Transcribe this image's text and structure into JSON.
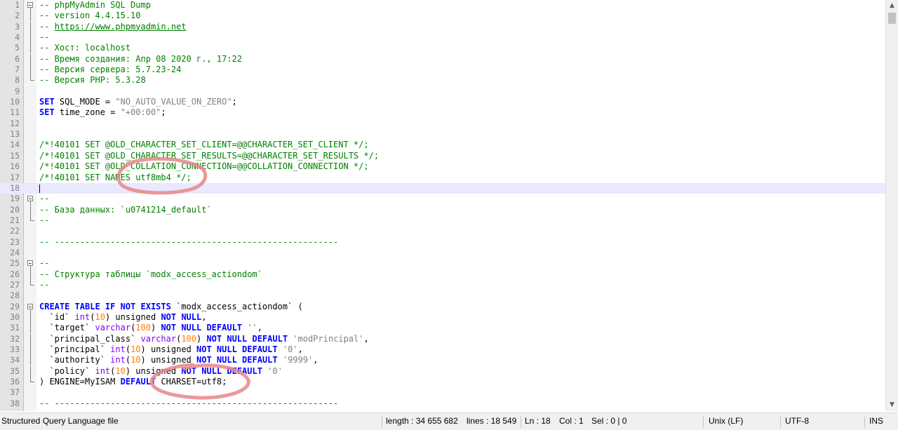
{
  "editor": {
    "current_line": 18,
    "lines": [
      {
        "n": "1",
        "fold": "open",
        "segs": [
          [
            "comment",
            "-- phpMyAdmin SQL Dump"
          ]
        ]
      },
      {
        "n": "2",
        "fold": "mid",
        "segs": [
          [
            "comment",
            "-- version 4.4.15.10"
          ]
        ]
      },
      {
        "n": "3",
        "fold": "mid",
        "segs": [
          [
            "comment",
            "-- "
          ],
          [
            "link",
            "https://www.phpmyadmin.net"
          ]
        ]
      },
      {
        "n": "4",
        "fold": "mid",
        "segs": [
          [
            "comment",
            "--"
          ]
        ]
      },
      {
        "n": "5",
        "fold": "mid",
        "segs": [
          [
            "comment",
            "-- Хост: localhost"
          ]
        ]
      },
      {
        "n": "6",
        "fold": "mid",
        "segs": [
          [
            "comment",
            "-- Время создания: Апр 08 2020 г., 17:22"
          ]
        ]
      },
      {
        "n": "7",
        "fold": "mid",
        "segs": [
          [
            "comment",
            "-- Версия сервера: 5.7.23-24"
          ]
        ]
      },
      {
        "n": "8",
        "fold": "end",
        "segs": [
          [
            "comment",
            "-- Версия PHP: 5.3.28"
          ]
        ]
      },
      {
        "n": "9",
        "fold": "",
        "segs": []
      },
      {
        "n": "10",
        "fold": "",
        "segs": [
          [
            "kw",
            "SET"
          ],
          [
            "txt",
            " SQL_MODE = "
          ],
          [
            "str",
            "\"NO_AUTO_VALUE_ON_ZERO\""
          ],
          [
            "txt",
            ";"
          ]
        ]
      },
      {
        "n": "11",
        "fold": "",
        "segs": [
          [
            "kw",
            "SET"
          ],
          [
            "txt",
            " time_zone = "
          ],
          [
            "str",
            "\"+00:00\""
          ],
          [
            "txt",
            ";"
          ]
        ]
      },
      {
        "n": "12",
        "fold": "",
        "segs": []
      },
      {
        "n": "13",
        "fold": "",
        "segs": []
      },
      {
        "n": "14",
        "fold": "",
        "segs": [
          [
            "comment",
            "/*!40101 SET @OLD_CHARACTER_SET_CLIENT=@@CHARACTER_SET_CLIENT */;"
          ]
        ]
      },
      {
        "n": "15",
        "fold": "",
        "segs": [
          [
            "comment",
            "/*!40101 SET @OLD_CHARACTER_SET_RESULTS=@@CHARACTER_SET_RESULTS */;"
          ]
        ]
      },
      {
        "n": "16",
        "fold": "",
        "segs": [
          [
            "comment",
            "/*!40101 SET @OLD_COLLATION_CONNECTION=@@COLLATION_CONNECTION */;"
          ]
        ]
      },
      {
        "n": "17",
        "fold": "",
        "segs": [
          [
            "comment",
            "/*!40101 SET NAMES utf8mb4 */;"
          ]
        ]
      },
      {
        "n": "18",
        "fold": "",
        "segs": []
      },
      {
        "n": "19",
        "fold": "open",
        "segs": [
          [
            "comment",
            "--"
          ]
        ]
      },
      {
        "n": "20",
        "fold": "mid",
        "segs": [
          [
            "comment",
            "-- База данных: `u0741214_default`"
          ]
        ]
      },
      {
        "n": "21",
        "fold": "end",
        "segs": [
          [
            "comment",
            "--"
          ]
        ]
      },
      {
        "n": "22",
        "fold": "",
        "segs": []
      },
      {
        "n": "23",
        "fold": "",
        "segs": [
          [
            "comment",
            "-- --------------------------------------------------------"
          ]
        ]
      },
      {
        "n": "24",
        "fold": "",
        "segs": []
      },
      {
        "n": "25",
        "fold": "open",
        "segs": [
          [
            "comment",
            "--"
          ]
        ]
      },
      {
        "n": "26",
        "fold": "mid",
        "segs": [
          [
            "comment",
            "-- Структура таблицы `modx_access_actiondom`"
          ]
        ]
      },
      {
        "n": "27",
        "fold": "end",
        "segs": [
          [
            "comment",
            "--"
          ]
        ]
      },
      {
        "n": "28",
        "fold": "",
        "segs": []
      },
      {
        "n": "29",
        "fold": "open",
        "segs": [
          [
            "kw",
            "CREATE TABLE IF NOT EXISTS"
          ],
          [
            "txt",
            " `modx_access_actiondom` ("
          ]
        ]
      },
      {
        "n": "30",
        "fold": "mid",
        "segs": [
          [
            "txt",
            "  `id` "
          ],
          [
            "fn",
            "int"
          ],
          [
            "txt",
            "("
          ],
          [
            "num",
            "10"
          ],
          [
            "txt",
            ") unsigned "
          ],
          [
            "kw",
            "NOT NULL"
          ],
          [
            "txt",
            ","
          ]
        ]
      },
      {
        "n": "31",
        "fold": "mid",
        "segs": [
          [
            "txt",
            "  `target` "
          ],
          [
            "fn",
            "varchar"
          ],
          [
            "txt",
            "("
          ],
          [
            "num",
            "100"
          ],
          [
            "txt",
            ") "
          ],
          [
            "kw",
            "NOT NULL DEFAULT"
          ],
          [
            "txt",
            " "
          ],
          [
            "str",
            "''"
          ],
          [
            "txt",
            ","
          ]
        ]
      },
      {
        "n": "32",
        "fold": "mid",
        "segs": [
          [
            "txt",
            "  `principal_class` "
          ],
          [
            "fn",
            "varchar"
          ],
          [
            "txt",
            "("
          ],
          [
            "num",
            "100"
          ],
          [
            "txt",
            ") "
          ],
          [
            "kw",
            "NOT NULL DEFAULT"
          ],
          [
            "txt",
            " "
          ],
          [
            "str",
            "'modPrincipal'"
          ],
          [
            "txt",
            ","
          ]
        ]
      },
      {
        "n": "33",
        "fold": "mid",
        "segs": [
          [
            "txt",
            "  `principal` "
          ],
          [
            "fn",
            "int"
          ],
          [
            "txt",
            "("
          ],
          [
            "num",
            "10"
          ],
          [
            "txt",
            ") unsigned "
          ],
          [
            "kw",
            "NOT NULL DEFAULT"
          ],
          [
            "txt",
            " "
          ],
          [
            "str",
            "'0'"
          ],
          [
            "txt",
            ","
          ]
        ]
      },
      {
        "n": "34",
        "fold": "mid",
        "segs": [
          [
            "txt",
            "  `authority` "
          ],
          [
            "fn",
            "int"
          ],
          [
            "txt",
            "("
          ],
          [
            "num",
            "10"
          ],
          [
            "txt",
            ") unsigned "
          ],
          [
            "kw",
            "NOT NULL DEFAULT"
          ],
          [
            "txt",
            " "
          ],
          [
            "str",
            "'9999'"
          ],
          [
            "txt",
            ","
          ]
        ]
      },
      {
        "n": "35",
        "fold": "mid",
        "segs": [
          [
            "txt",
            "  `policy` "
          ],
          [
            "fn",
            "int"
          ],
          [
            "txt",
            "("
          ],
          [
            "num",
            "10"
          ],
          [
            "txt",
            ") unsigned "
          ],
          [
            "kw",
            "NOT NULL DEFAULT"
          ],
          [
            "txt",
            " "
          ],
          [
            "str",
            "'0'"
          ]
        ]
      },
      {
        "n": "36",
        "fold": "end",
        "segs": [
          [
            "txt",
            ") ENGINE=MyISAM "
          ],
          [
            "kw",
            "DEFAULT"
          ],
          [
            "txt",
            " CHARSET=utf8;"
          ]
        ]
      },
      {
        "n": "37",
        "fold": "",
        "segs": []
      },
      {
        "n": "38",
        "fold": "",
        "segs": [
          [
            "comment",
            "-- --------------------------------------------------------"
          ]
        ]
      }
    ]
  },
  "status_bar": {
    "file_type": "Structured Query Language file",
    "length": "length : 34 655 682",
    "lines": "lines : 18 549",
    "ln": "Ln : 18",
    "col": "Col : 1",
    "sel": "Sel : 0 | 0",
    "eol": "Unix (LF)",
    "encoding": "UTF-8",
    "mode": "INS"
  },
  "scrollbar": {
    "up_icon": "triangle-up-icon",
    "down_icon": "triangle-down-icon"
  },
  "annotations": {
    "color": "#e8868a",
    "description_marks": [
      "handwritten-circle-line-17",
      "handwritten-circle-line-36"
    ]
  }
}
